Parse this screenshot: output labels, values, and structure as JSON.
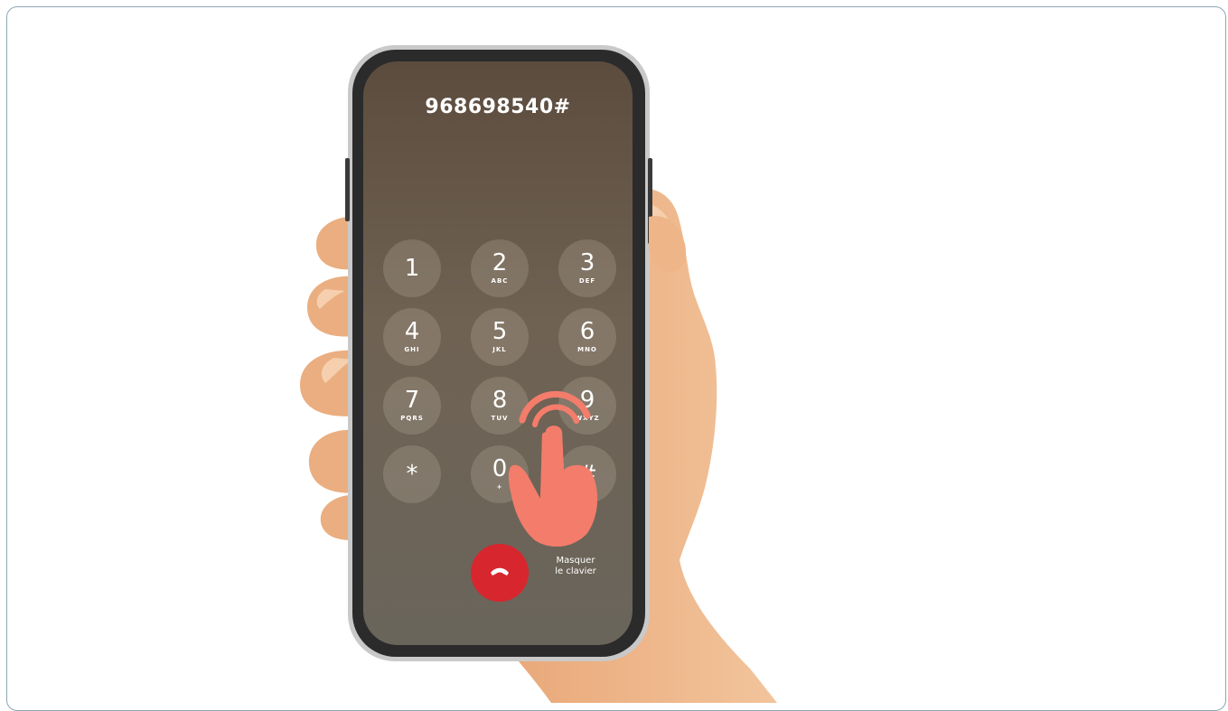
{
  "dialer": {
    "dialed_number": "968698540#",
    "keys": [
      {
        "digit": "1",
        "letters": ""
      },
      {
        "digit": "2",
        "letters": "ABC"
      },
      {
        "digit": "3",
        "letters": "DEF"
      },
      {
        "digit": "4",
        "letters": "GHI"
      },
      {
        "digit": "5",
        "letters": "JKL"
      },
      {
        "digit": "6",
        "letters": "MNO"
      },
      {
        "digit": "7",
        "letters": "PQRS"
      },
      {
        "digit": "8",
        "letters": "TUV"
      },
      {
        "digit": "9",
        "letters": "WXYZ"
      },
      {
        "digit": "*",
        "letters": ""
      },
      {
        "digit": "0",
        "letters": "+"
      },
      {
        "digit": "#",
        "letters": ""
      }
    ],
    "hide_keyboard_line1": "Masquer",
    "hide_keyboard_line2": "le clavier"
  },
  "icons": {
    "end_call": "phone-hangup-icon",
    "tap_gesture": "tap-gesture-icon"
  },
  "colors": {
    "end_call": "#d8262e",
    "tap_gesture": "#f47c6b",
    "skin": "#eeb589",
    "phone_body": "#2a2a2a",
    "screen_top": "#5d4d3f",
    "screen_bottom": "#6c6559"
  }
}
